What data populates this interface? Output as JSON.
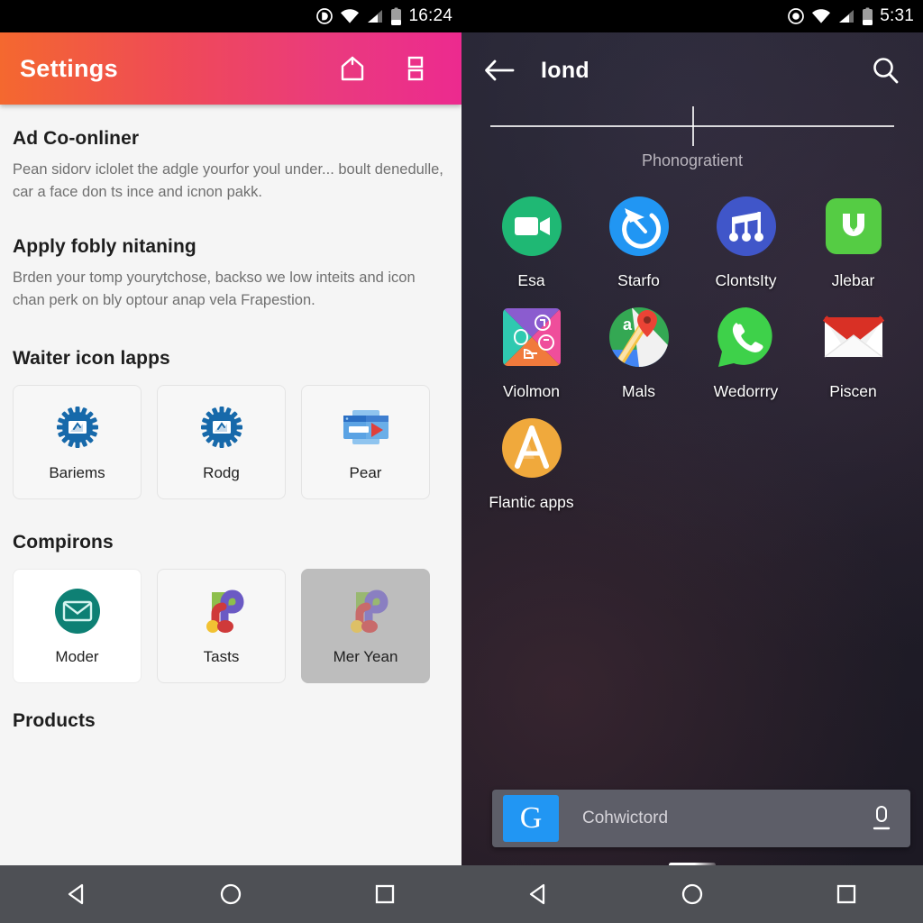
{
  "left": {
    "status_bar": {
      "time": "16:24",
      "icons": [
        "dnd-icon",
        "wifi-icon",
        "signal-icon",
        "battery-icon"
      ]
    },
    "app_bar": {
      "title": "Settings",
      "home_icon": "home-icon",
      "grid_icon": "grid-icon"
    },
    "sections": [
      {
        "title": "Ad Co-onliner",
        "body": "Pean sidorv iclolet the adgle yourfor youl under... boult denedulle, car a face don ts ince and icnon pakk."
      },
      {
        "title": "Apply fobly nitaning",
        "body": "Brden your tomp yourytchose, backso we low inteits and icon chan perk on bly optour anap vela Frapestion."
      }
    ],
    "icon_apps": {
      "title": "Waiter icon lapps",
      "cards": [
        {
          "label": "Bariems",
          "icon": "gear-photo-icon",
          "state": "default"
        },
        {
          "label": "Rodg",
          "icon": "gear-photo-icon",
          "state": "default"
        },
        {
          "label": "Pear",
          "icon": "blue-player-icon",
          "state": "default"
        }
      ]
    },
    "compirons": {
      "title": "Compirons",
      "cards": [
        {
          "label": "Moder",
          "icon": "teal-envelope-icon",
          "state": "white"
        },
        {
          "label": "Tasts",
          "icon": "colorful-swirl-icon",
          "state": "default"
        },
        {
          "label": "Mer Yean",
          "icon": "colorful-swirl-icon",
          "state": "selected"
        }
      ]
    },
    "products": {
      "title": "Products"
    },
    "nav_bar": {
      "back": "back-triangle-icon",
      "home": "home-circle-icon",
      "recents": "recents-square-icon"
    }
  },
  "right": {
    "status_bar": {
      "time": "5:31",
      "icons": [
        "dnd-icon",
        "wifi-icon",
        "signal-icon",
        "battery-icon"
      ]
    },
    "folder": {
      "back_icon": "arrow-back-icon",
      "title": "Iond",
      "search_icon": "search-icon",
      "subtitle": "Phonogratient"
    },
    "apps": [
      [
        {
          "label": "Esa",
          "icon": "video-camera-icon",
          "color": "#1fb874"
        },
        {
          "label": "Starfo",
          "icon": "restore-arrow-icon",
          "color": "#2196f3"
        },
        {
          "label": "ClontsIty",
          "icon": "music-note-icon",
          "color": "#4056c9"
        },
        {
          "label": "Jlebar",
          "icon": "green-shield-icon",
          "color": "#55cc44"
        }
      ],
      [
        {
          "label": "Violmon",
          "icon": "quad-collage-icon",
          "color": "#8b5ccf"
        },
        {
          "label": "Mals",
          "icon": "maps-pin-icon",
          "color": "#34a853"
        },
        {
          "label": "Wedorrry",
          "icon": "whatsapp-phone-icon",
          "color": "#3ed14a"
        },
        {
          "label": "Piscen",
          "icon": "gmail-envelope-icon",
          "color": "#d93025"
        }
      ],
      [
        {
          "label": "Flantic apps",
          "icon": "letter-a-icon",
          "color": "#f0a93c"
        }
      ]
    ],
    "search_bar": {
      "logo": "G",
      "text": "Cohwictord",
      "mic_icon": "mic-icon"
    },
    "nav_bar": {
      "back": "back-triangle-icon",
      "home": "home-circle-icon",
      "recents": "recents-square-icon"
    }
  },
  "colors": {
    "appbar_start": "#f4682f",
    "appbar_end": "#ec2a8f",
    "nav_bar": "#4e5055",
    "selected_card": "#bdbdbd",
    "search_bar": "#5d5e68",
    "google_blue": "#2196f3"
  }
}
